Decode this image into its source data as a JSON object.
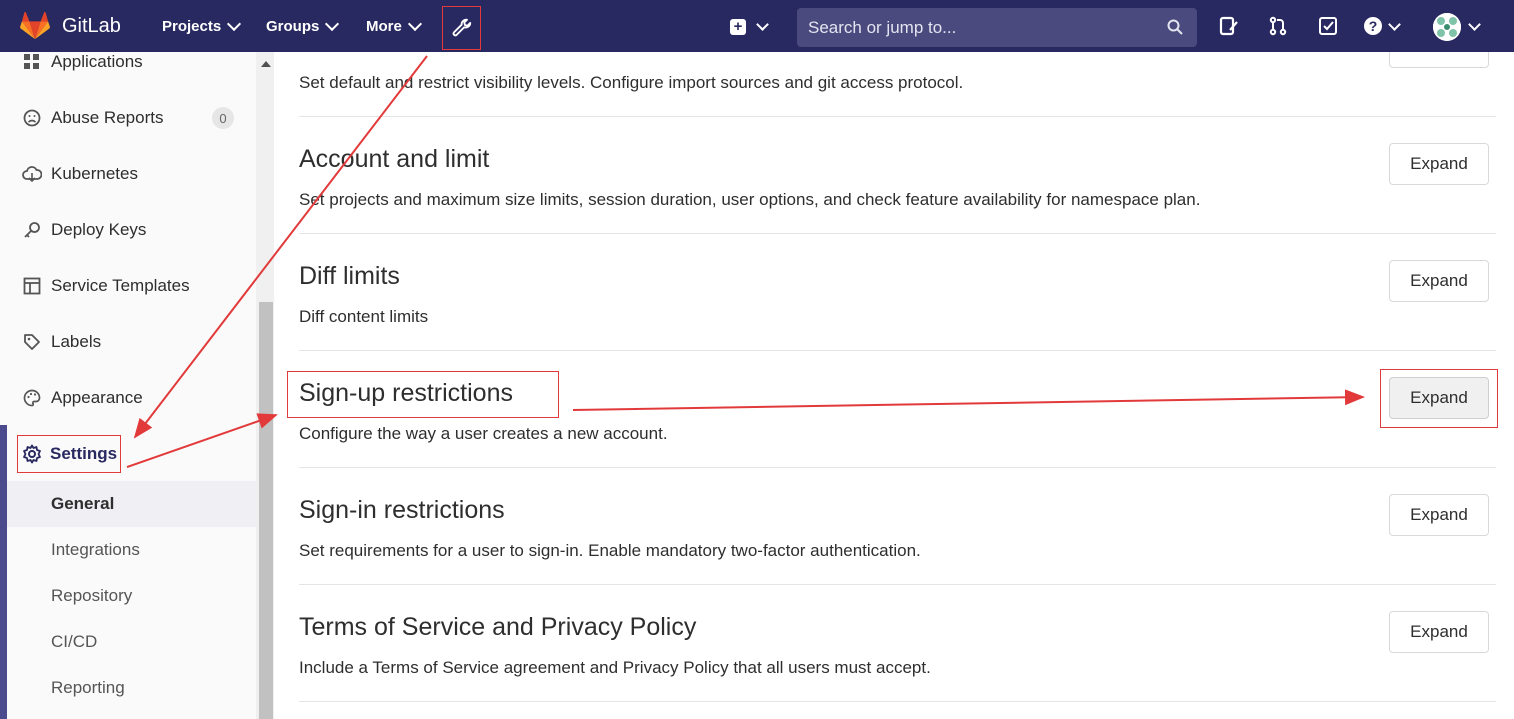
{
  "navbar": {
    "brand": "GitLab",
    "links": [
      "Projects",
      "Groups",
      "More"
    ],
    "search_placeholder": "Search or jump to...",
    "bg_color": "#292961"
  },
  "sidebar": {
    "items": [
      {
        "label": "Applications",
        "icon": "applications-icon"
      },
      {
        "label": "Abuse Reports",
        "icon": "abuse-reports-icon",
        "badge": "0"
      },
      {
        "label": "Kubernetes",
        "icon": "kubernetes-icon"
      },
      {
        "label": "Deploy Keys",
        "icon": "key-icon"
      },
      {
        "label": "Service Templates",
        "icon": "service-templates-icon"
      },
      {
        "label": "Labels",
        "icon": "label-icon"
      },
      {
        "label": "Appearance",
        "icon": "appearance-icon"
      }
    ],
    "settings": {
      "label": "Settings",
      "icon": "gear-icon",
      "sub_items": [
        "General",
        "Integrations",
        "Repository",
        "CI/CD",
        "Reporting"
      ],
      "active": "General"
    }
  },
  "main": {
    "top_partial_desc": "Set default and restrict visibility levels. Configure import sources and git access protocol.",
    "sections": [
      {
        "title": "Account and limit",
        "desc": "Set projects and maximum size limits, session duration, user options, and check feature availability for namespace plan.",
        "button": "Expand"
      },
      {
        "title": "Diff limits",
        "desc": "Diff content limits",
        "button": "Expand"
      },
      {
        "title": "Sign-up restrictions",
        "desc": "Configure the way a user creates a new account.",
        "button": "Expand"
      },
      {
        "title": "Sign-in restrictions",
        "desc": "Set requirements for a user to sign-in. Enable mandatory two-factor authentication.",
        "button": "Expand"
      },
      {
        "title": "Terms of Service and Privacy Policy",
        "desc": "Include a Terms of Service agreement and Privacy Policy that all users must accept.",
        "button": "Expand"
      }
    ]
  },
  "annotation_color": "#e23a3a"
}
